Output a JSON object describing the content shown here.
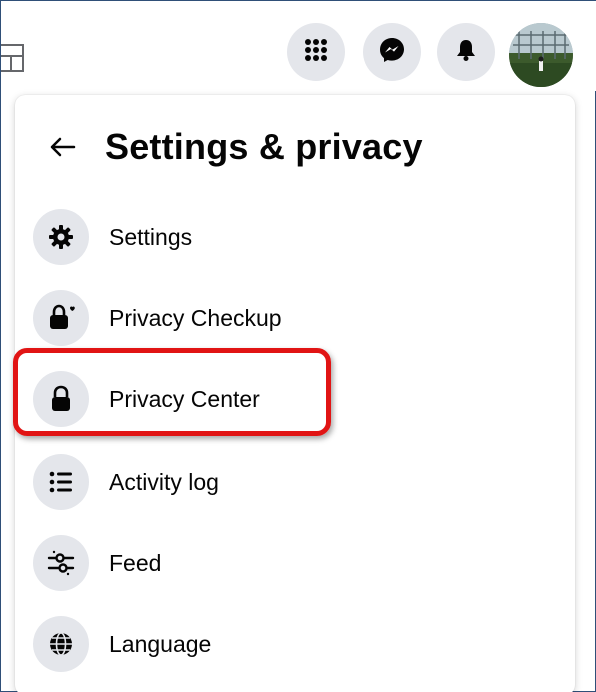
{
  "panel": {
    "title": "Settings & privacy"
  },
  "menu": {
    "items": [
      {
        "label": "Settings",
        "icon": "gear-icon"
      },
      {
        "label": "Privacy Checkup",
        "icon": "lock-heart-icon"
      },
      {
        "label": "Privacy Center",
        "icon": "lock-icon"
      },
      {
        "label": "Activity log",
        "icon": "list-icon"
      },
      {
        "label": "Feed",
        "icon": "sliders-icon"
      },
      {
        "label": "Language",
        "icon": "globe-icon"
      }
    ]
  },
  "topbar": {
    "buttons": [
      "menu-grid-icon",
      "messenger-icon",
      "notifications-bell-icon",
      "profile-avatar"
    ]
  },
  "colors": {
    "highlight": "#e11414",
    "icon_bg": "#e4e6eb",
    "text": "#050505"
  }
}
